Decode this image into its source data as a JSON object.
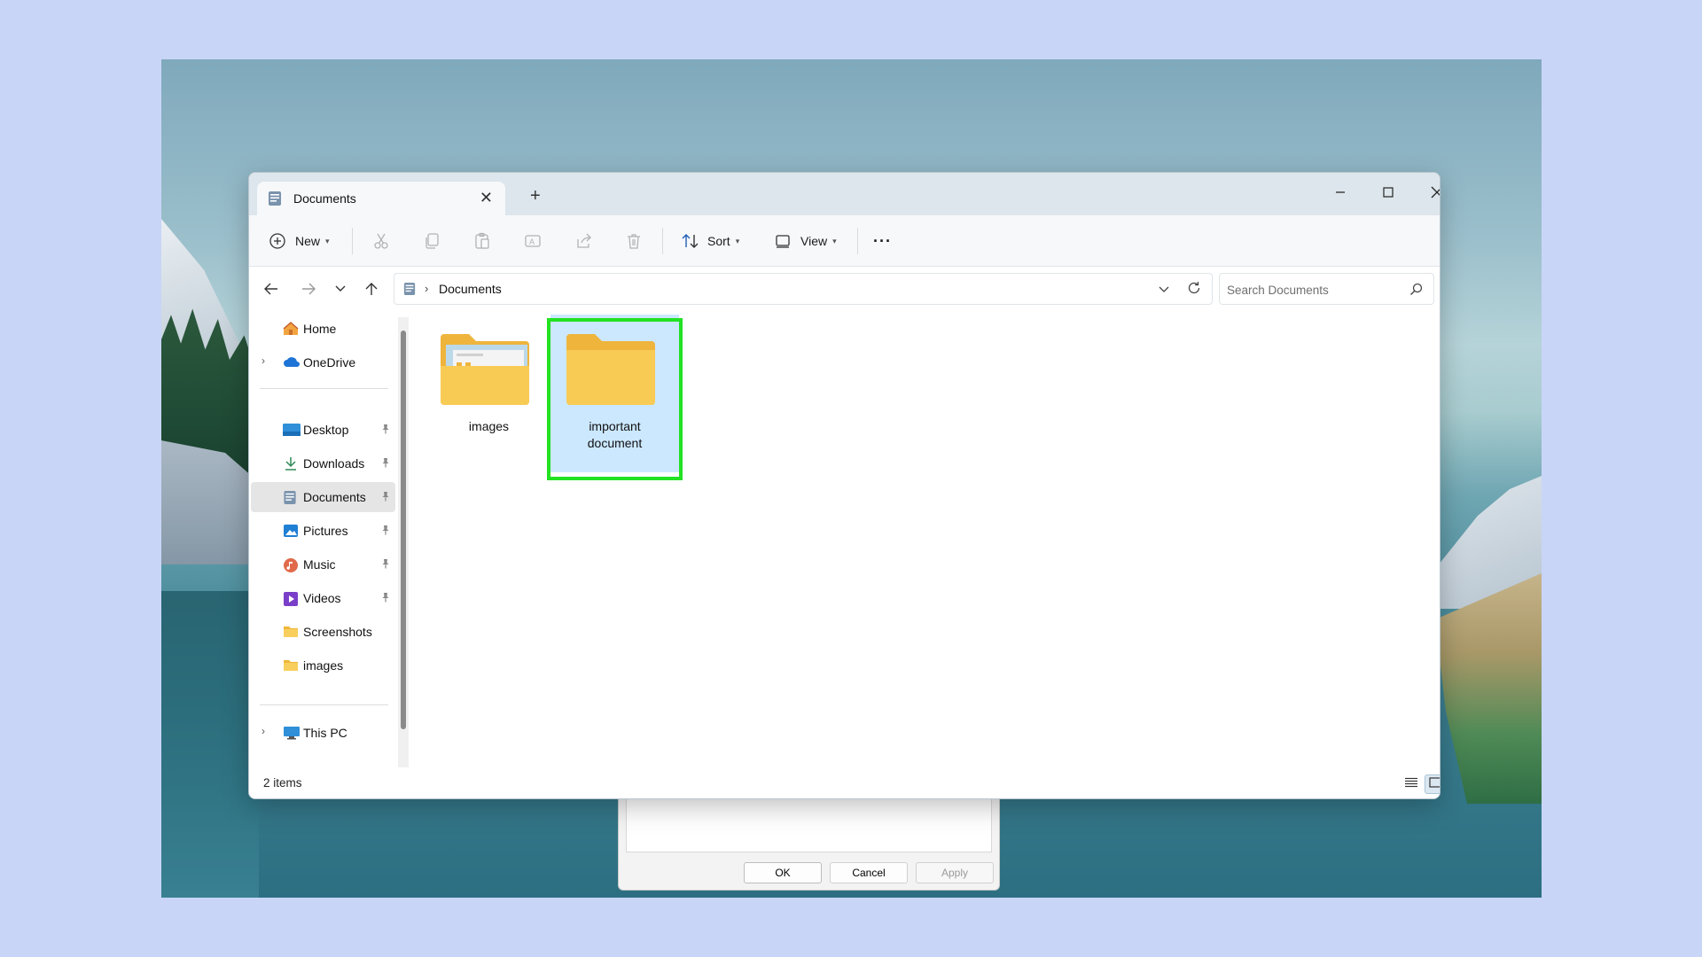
{
  "window": {
    "tab_title": "Documents",
    "address_crumb": "Documents",
    "search_placeholder": "Search Documents"
  },
  "toolbar": {
    "new_label": "New",
    "sort_label": "Sort",
    "view_label": "View",
    "more_label": "···"
  },
  "sidebar": {
    "items": [
      {
        "label": "Home",
        "icon": "home-icon"
      },
      {
        "label": "OneDrive",
        "icon": "cloud-icon"
      },
      {
        "label": "Desktop",
        "icon": "desktop-icon"
      },
      {
        "label": "Downloads",
        "icon": "download-icon"
      },
      {
        "label": "Documents",
        "icon": "documents-icon"
      },
      {
        "label": "Pictures",
        "icon": "pictures-icon"
      },
      {
        "label": "Music",
        "icon": "music-icon"
      },
      {
        "label": "Videos",
        "icon": "videos-icon"
      },
      {
        "label": "Screenshots",
        "icon": "folder-icon"
      },
      {
        "label": "images",
        "icon": "folder-icon"
      },
      {
        "label": "This PC",
        "icon": "pc-icon"
      }
    ],
    "selected": "Documents"
  },
  "files": [
    {
      "name": "images",
      "type": "folder"
    },
    {
      "name": "important document",
      "type": "folder",
      "selected": true,
      "highlighted": true
    }
  ],
  "status": {
    "item_count": "2 items"
  },
  "background_dialog": {
    "ok_label": "OK",
    "cancel_label": "Cancel",
    "apply_label": "Apply"
  },
  "colors": {
    "highlight": "#22e222",
    "folder": "#f8ca4f",
    "selection": "#cce8ff"
  }
}
